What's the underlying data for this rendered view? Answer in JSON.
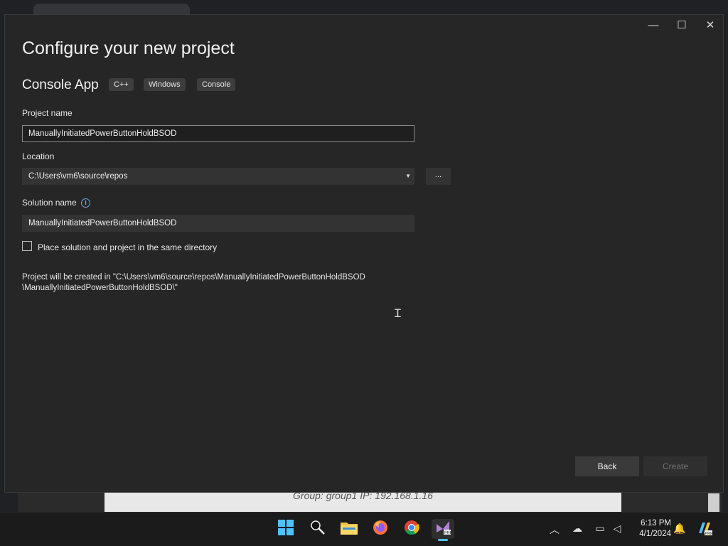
{
  "window": {
    "minimize": "—",
    "maximize": "☐",
    "close": "✕"
  },
  "dialog": {
    "title": "Configure your new project",
    "template_name": "Console App",
    "tags": [
      "C++",
      "Windows",
      "Console"
    ]
  },
  "form": {
    "project_name_label": "Project name",
    "project_name_value": "ManuallyInitiatedPowerButtonHoldBSOD",
    "location_label": "Location",
    "location_value": "C:\\Users\\vm6\\source\\repos",
    "browse_label": "...",
    "solution_name_label": "Solution name",
    "solution_name_value": "ManuallyInitiatedPowerButtonHoldBSOD",
    "same_dir_label": "Place solution and project in the same directory",
    "same_dir_checked": false,
    "created_note_line1": "Project will be created in \"C:\\Users\\vm6\\source\\repos\\ManuallyInitiatedPowerButtonHoldBSOD",
    "created_note_line2": "\\ManuallyInitiatedPowerButtonHoldBSOD\\\""
  },
  "buttons": {
    "back": "Back",
    "create": "Create"
  },
  "background": {
    "page_text": "Group: group1   IP: 192.168.1.16"
  },
  "taskbar": {
    "icons": [
      "windows-start-icon",
      "search-icon",
      "file-explorer-icon",
      "firefox-icon",
      "chrome-icon",
      "visual-studio-icon"
    ],
    "time": "6:13 PM",
    "date": "4/1/2024"
  },
  "colors": {
    "accent": "#6aa9e6",
    "dialog_bg": "#262626"
  }
}
